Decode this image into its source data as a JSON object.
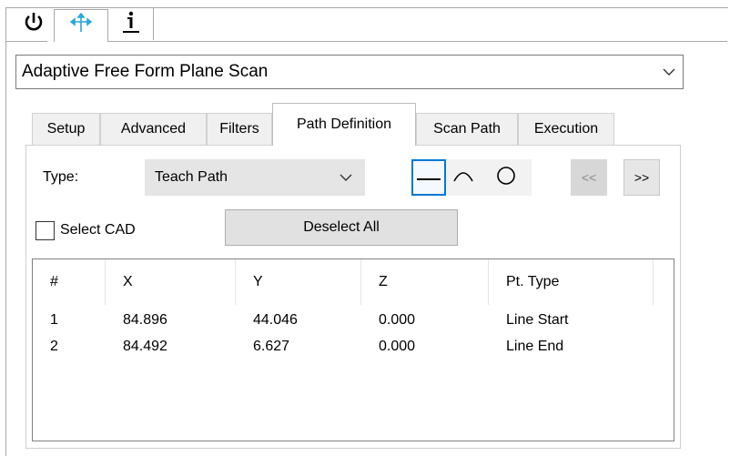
{
  "toolbar_icons": [
    "power-icon",
    "move-axes-icon",
    "info-icon"
  ],
  "procedure": {
    "selected": "Adaptive Free Form Plane Scan"
  },
  "tabs": [
    {
      "label": "Setup",
      "active": false
    },
    {
      "label": "Advanced",
      "active": false
    },
    {
      "label": "Filters",
      "active": false
    },
    {
      "label": "Path Definition",
      "active": true
    },
    {
      "label": "Scan Path",
      "active": false
    },
    {
      "label": "Execution",
      "active": false
    }
  ],
  "path_definition": {
    "type_label": "Type:",
    "type_value": "Teach Path",
    "segment_tools": [
      "line-icon",
      "arc-icon",
      "circle-icon"
    ],
    "active_tool": "line-icon",
    "prev_label": "<<",
    "next_label": ">>",
    "select_cad_label": "Select CAD",
    "select_cad_checked": false,
    "deselect_all_label": "Deselect All"
  },
  "points_table": {
    "columns": [
      "#",
      "X",
      "Y",
      "Z",
      "Pt. Type"
    ],
    "rows": [
      [
        "1",
        "84.896",
        "44.046",
        "0.000",
        "Line Start"
      ],
      [
        "2",
        "84.492",
        "6.627",
        "0.000",
        "Line End"
      ]
    ]
  },
  "colors": {
    "accent": "#0078d7",
    "move_icon": "#2aa7d9"
  }
}
